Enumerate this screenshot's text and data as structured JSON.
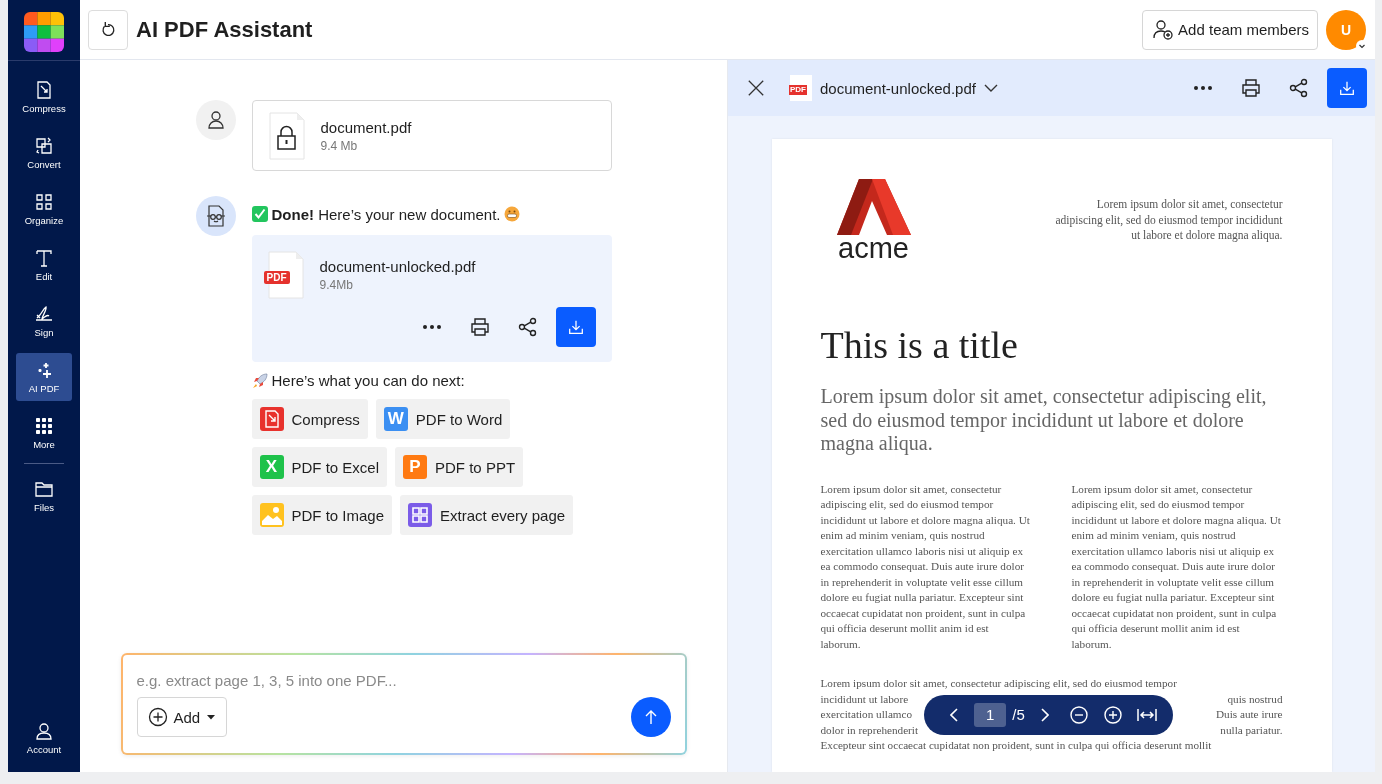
{
  "sidebar": {
    "tools": [
      {
        "label": "Compress",
        "selected": false
      },
      {
        "label": "Convert",
        "selected": false
      },
      {
        "label": "Organize",
        "selected": false
      },
      {
        "label": "Edit",
        "selected": false
      },
      {
        "label": "Sign",
        "selected": false
      },
      {
        "label": "AI PDF",
        "selected": true
      },
      {
        "label": "More",
        "selected": false
      }
    ],
    "files": {
      "label": "Files",
      "selected": false
    },
    "account": {
      "label": "Account",
      "selected": false
    }
  },
  "header": {
    "title": "AI PDF Assistant",
    "team_button": "Add team members",
    "avatar": "U"
  },
  "chat": {
    "messages": [
      {
        "kind": "user_file",
        "file": {
          "name": "document.pdf",
          "size": "9.4 Mb"
        }
      },
      {
        "kind": "bot_result",
        "text": "**Done!** Here’s your new document.",
        "file": {
          "name": "document-unlocked.pdf",
          "size": "9.4Mb",
          "badge": "PDF"
        }
      }
    ],
    "next_heading": "Here’s what you can do next:",
    "actions": [
      {
        "label": "Compress",
        "color": "#e8322d"
      },
      {
        "label": "PDF to Word",
        "color": "#3b8ff2",
        "badge": "W"
      },
      {
        "label": "PDF to Excel",
        "color": "#1ec24a",
        "badge": "X"
      },
      {
        "label": "PDF to PPT",
        "color": "#ff7a12",
        "badge": "P"
      },
      {
        "label": "PDF to Image",
        "color": "#ffc21f"
      },
      {
        "label": "Extract every page",
        "color": "#7b5ce8"
      }
    ]
  },
  "composer": {
    "placeholder": "e.g. extract page 1, 3, 5 into one PDF...",
    "add_label": "Add"
  },
  "viewer": {
    "file_name": "document-unlocked.pdf",
    "badge": "PDF",
    "document": {
      "logo_text": "acme",
      "header_text": "Lorem ipsum dolor sit amet, consectetur adipiscing elit, sed do eiusmod tempor incididunt ut labore et dolore magna aliqua.",
      "title": "This is a title",
      "subtitle": "Lorem ipsum dolor sit amet, consectetur adipiscing elit, sed do eiusmod tempor incididunt ut labore et dolore magna aliqua.",
      "columns": [
        "Lorem ipsum dolor sit amet, consectetur adipiscing elit, sed do eiusmod tempor incididunt ut labore et dolore magna aliqua. Ut enim ad minim veniam, quis nostrud exercitation ullamco laboris nisi ut aliquip ex ea commodo consequat. Duis aute irure dolor in reprehenderit in voluptate velit esse cillum dolore eu fugiat nulla pariatur. Excepteur sint occaecat cupidatat non proident, sunt in culpa qui officia deserunt mollit anim id est laborum.",
        "Lorem ipsum dolor sit amet, consectetur adipiscing elit, sed do eiusmod tempor incididunt ut labore et dolore magna aliqua. Ut enim ad minim veniam, quis nostrud exercitation ullamco laboris nisi ut aliquip ex ea commodo consequat. Duis aute irure dolor in reprehenderit in voluptate velit esse cillum dolore eu fugiat nulla pariatur. Excepteur sint occaecat cupidatat non proident, sunt in culpa qui officia deserunt mollit anim id est laborum."
      ],
      "paragraph_top": "Lorem ipsum dolor sit amet, consectetur adipiscing elit, sed do eiusmod tempor",
      "paragraph_left": [
        "incididunt ut labore",
        "exercitation ullamco",
        "dolor in reprehenderit"
      ],
      "paragraph_right": [
        "quis nostrud",
        "Duis aute irure",
        "nulla pariatur."
      ],
      "paragraph_bottom": "Excepteur sint occaecat cupidatat non proident, sunt in culpa qui officia deserunt mollit"
    },
    "pager": {
      "page": "1",
      "total": "/5"
    }
  }
}
